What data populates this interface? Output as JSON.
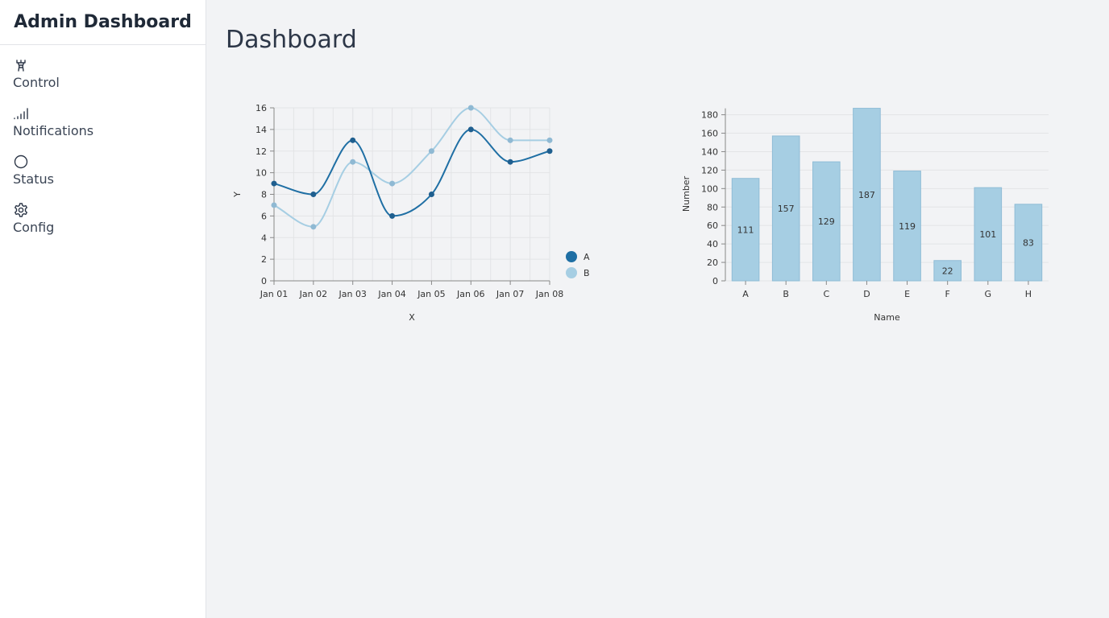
{
  "sidebar": {
    "title": "Admin Dashboard",
    "items": [
      {
        "label": "Control",
        "icon": "tower-icon"
      },
      {
        "label": "Notifications",
        "icon": "signal-bars-icon"
      },
      {
        "label": "Status",
        "icon": "circle-icon"
      },
      {
        "label": "Config",
        "icon": "gear-icon"
      }
    ]
  },
  "main": {
    "title": "Dashboard"
  },
  "chart_data": [
    {
      "type": "line",
      "x": [
        "Jan 01",
        "Jan 02",
        "Jan 03",
        "Jan 04",
        "Jan 05",
        "Jan 06",
        "Jan 07",
        "Jan 08"
      ],
      "series": [
        {
          "name": "A",
          "values": [
            9,
            8,
            13,
            6,
            8,
            14,
            11,
            12
          ],
          "color": "#1f6fa4"
        },
        {
          "name": "B",
          "values": [
            7,
            5,
            11,
            9,
            12,
            16,
            13,
            13
          ],
          "color": "#a6cee3"
        }
      ],
      "xlabel": "X",
      "ylabel": "Y",
      "ylim": [
        0,
        16
      ],
      "yticks": [
        0,
        2,
        4,
        6,
        8,
        10,
        12,
        14,
        16
      ],
      "grid": true,
      "legend": "right"
    },
    {
      "type": "bar",
      "categories": [
        "A",
        "B",
        "C",
        "D",
        "E",
        "F",
        "G",
        "H"
      ],
      "values": [
        111,
        157,
        129,
        187,
        119,
        22,
        101,
        83
      ],
      "xlabel": "Name",
      "ylabel": "Number",
      "ylim": [
        0,
        180
      ],
      "yticks": [
        0,
        20,
        40,
        60,
        80,
        100,
        120,
        140,
        160,
        180
      ],
      "color": "#a6cee3",
      "grid": true,
      "data_labels": true
    }
  ]
}
